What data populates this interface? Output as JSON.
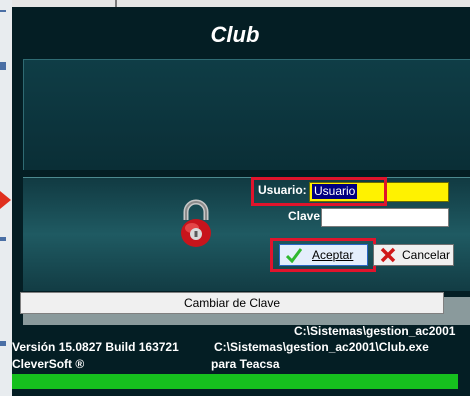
{
  "window": {
    "title": "Club"
  },
  "login": {
    "user_label": "Usuario:",
    "user_value": "Usuario",
    "password_label": "Clave:",
    "password_value": ""
  },
  "buttons": {
    "accept_label": "Aceptar",
    "cancel_label": "Cancelar",
    "change_password_label": "Cambiar de Clave"
  },
  "footer": {
    "path_top": "C:\\Sistemas\\gestion_ac2001",
    "version": "Versión 15.0827 Build 163721",
    "path_exe": "C:\\Sistemas\\gestion_ac2001\\Club.exe",
    "company": "CleverSoft ®",
    "client": "para Teacsa"
  },
  "progress": {
    "fraction": 1.0
  },
  "icons": [
    "padlock-icon",
    "check-icon",
    "x-icon"
  ],
  "colors": {
    "window_bg": "#041e24",
    "highlight": "#e0142c",
    "user_field_bg": "#fff200",
    "progress": "#16c01e"
  }
}
